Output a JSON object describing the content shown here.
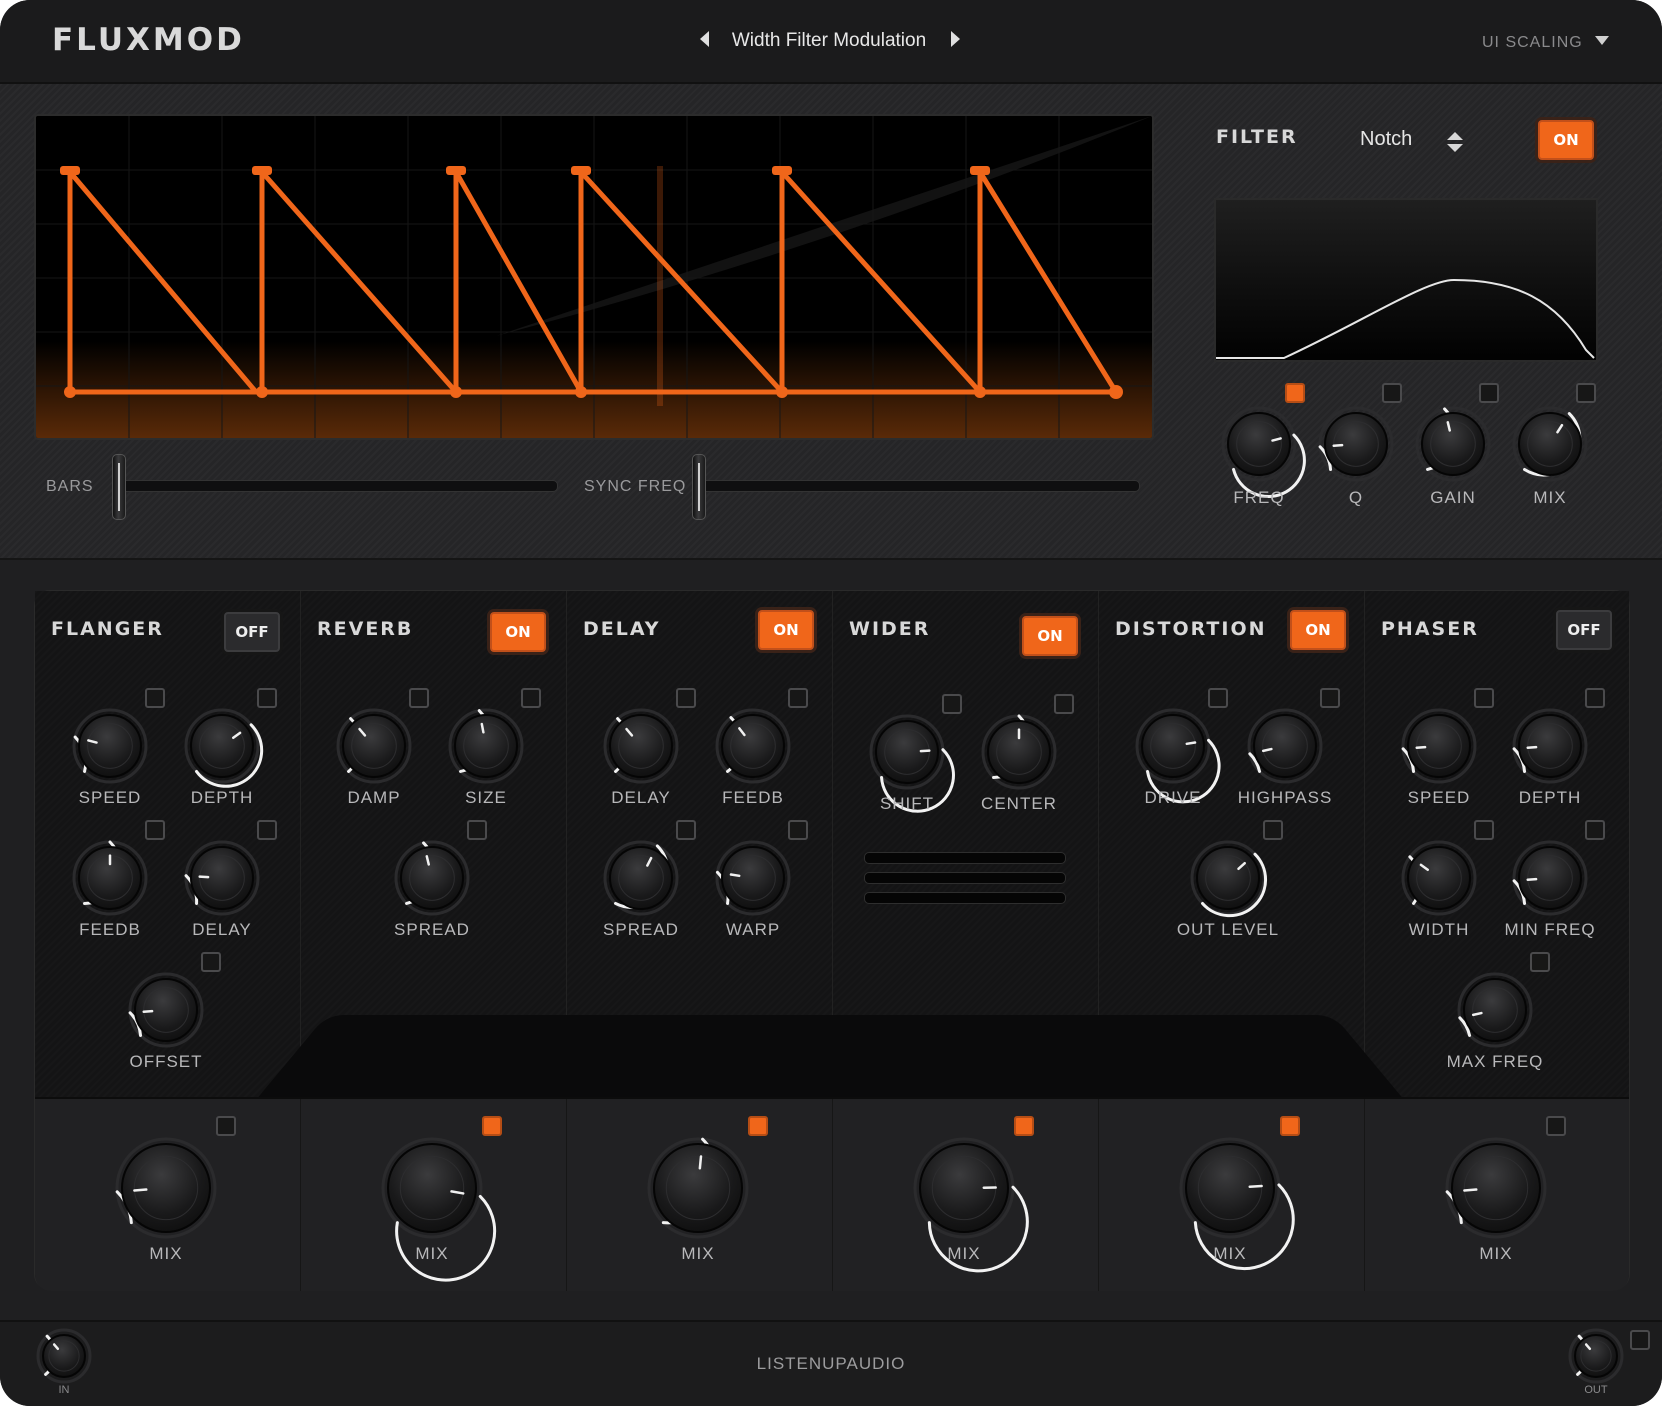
{
  "header": {
    "logo": "FLUXMOD",
    "preset_name": "Width Filter Modulation",
    "ui_scaling": "UI SCALING"
  },
  "lfo": {
    "bars_label": "BARS",
    "sync_freq_label": "SYNC FREQ",
    "bars_value": 0.0,
    "sync_freq_value": 0.0,
    "accent_color": "#f0661a"
  },
  "filter": {
    "title": "FILTER",
    "type": "Notch",
    "toggle": "ON",
    "knobs": [
      {
        "label": "FREQ",
        "value": 0.78
      },
      {
        "label": "Q",
        "value": 0.15
      },
      {
        "label": "GAIN",
        "value": 0.45
      },
      {
        "label": "MIX",
        "value": 0.62
      }
    ]
  },
  "modules": [
    {
      "title": "FLANGER",
      "toggle": "OFF",
      "knobs": [
        {
          "label": "SPEED",
          "value": 0.22
        },
        {
          "label": "DEPTH",
          "value": 0.7
        },
        {
          "label": "FEEDB",
          "value": 0.5
        },
        {
          "label": "DELAY",
          "value": 0.18
        },
        {
          "label": "OFFSET",
          "value": 0.15
        }
      ]
    },
    {
      "title": "REVERB",
      "toggle": "ON",
      "knobs": [
        {
          "label": "DAMP",
          "value": 0.35
        },
        {
          "label": "SIZE",
          "value": 0.46
        },
        {
          "label": "SPREAD",
          "value": 0.45
        }
      ]
    },
    {
      "title": "DELAY",
      "toggle": "ON",
      "knobs": [
        {
          "label": "DELAY",
          "value": 0.35
        },
        {
          "label": "FEEDB",
          "value": 0.36
        },
        {
          "label": "SPREAD",
          "value": 0.6
        },
        {
          "label": "WARP",
          "value": 0.2
        }
      ]
    },
    {
      "title": "WIDER",
      "toggle": "ON",
      "knobs": [
        {
          "label": "SHIFT",
          "value": 0.82
        },
        {
          "label": "CENTER",
          "value": 0.5
        }
      ]
    },
    {
      "title": "DISTORTION",
      "toggle": "ON",
      "knobs": [
        {
          "label": "DRIVE",
          "value": 0.8
        },
        {
          "label": "HIGHPASS",
          "value": 0.12
        },
        {
          "label": "OUT LEVEL",
          "value": 0.68
        }
      ]
    },
    {
      "title": "PHASER",
      "toggle": "OFF",
      "knobs": [
        {
          "label": "SPEED",
          "value": 0.15
        },
        {
          "label": "DEPTH",
          "value": 0.15
        },
        {
          "label": "WIDTH",
          "value": 0.3
        },
        {
          "label": "MIN FREQ",
          "value": 0.15
        },
        {
          "label": "MAX FREQ",
          "value": 0.12
        }
      ]
    }
  ],
  "mix": [
    {
      "label": "MIX",
      "value": 0.15,
      "active": false
    },
    {
      "label": "MIX",
      "value": 0.87,
      "active": true
    },
    {
      "label": "MIX",
      "value": 0.52,
      "active": true
    },
    {
      "label": "MIX",
      "value": 0.83,
      "active": true
    },
    {
      "label": "MIX",
      "value": 0.82,
      "active": true
    },
    {
      "label": "MIX",
      "value": 0.15,
      "active": false
    }
  ],
  "footer": {
    "brand": "LISTENUPAUDIO",
    "in_label": "IN",
    "out_label": "OUT"
  }
}
